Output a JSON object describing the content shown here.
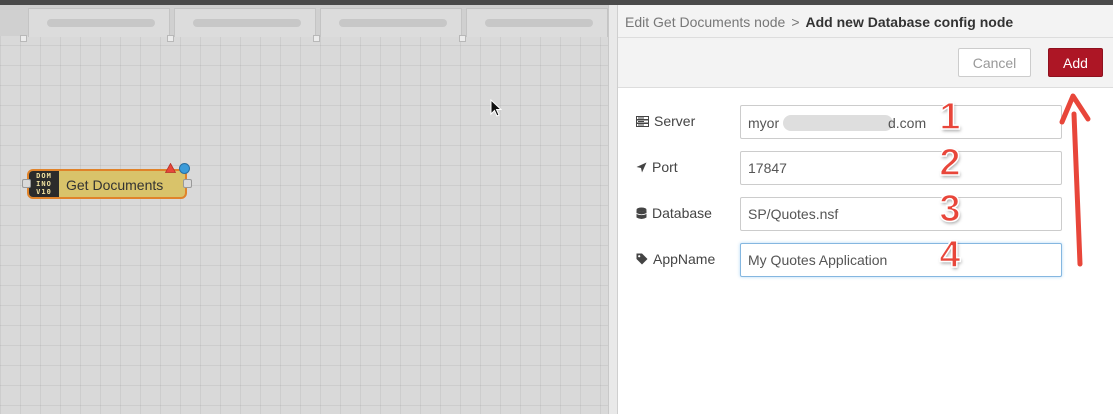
{
  "workspace": {
    "tabs": [
      "",
      "",
      "",
      ""
    ],
    "node": {
      "label": "Get Documents",
      "badge_lines": [
        "DOM",
        "INO",
        "V10"
      ]
    },
    "icons": [
      "cursor-arrow-icon",
      "warning-triangle-icon"
    ]
  },
  "tray": {
    "breadcrumb": {
      "parent": "Edit Get Documents node",
      "separator": ">",
      "current": "Add new Database config node"
    },
    "buttons": {
      "cancel": "Cancel",
      "add": "Add"
    },
    "fields": {
      "server": {
        "label": "Server",
        "icon": "server-icon",
        "value_start": "myor",
        "value_end": "d.com",
        "marker": "1"
      },
      "port": {
        "label": "Port",
        "icon": "location-arrow-icon",
        "value": "17847",
        "marker": "2"
      },
      "database": {
        "label": "Database",
        "icon": "database-icon",
        "value": "SP/Quotes.nsf",
        "marker": "3"
      },
      "appname": {
        "label": "AppName",
        "icon": "tag-icon",
        "value": "My Quotes Application",
        "marker": "4"
      }
    }
  },
  "colors": {
    "add_button": "#ad1625",
    "node_fill": "#d9c36a",
    "node_border": "#e0832a",
    "annotation": "#e8463a"
  }
}
